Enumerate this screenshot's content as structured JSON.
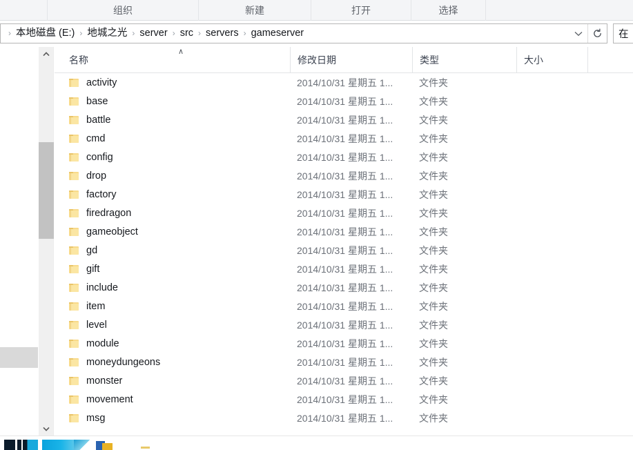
{
  "ribbon": {
    "groups": [
      {
        "label": "组织",
        "name": "organize"
      },
      {
        "label": "新建",
        "name": "new"
      },
      {
        "label": "打开",
        "name": "open"
      },
      {
        "label": "选择",
        "name": "select"
      }
    ]
  },
  "address_bar": {
    "separator": "›",
    "crumbs": [
      "本地磁盘 (E:)",
      "地城之光",
      "server",
      "src",
      "servers",
      "gameserver"
    ],
    "dropdown_icon": "chevron-down-icon",
    "refresh_icon": "refresh-icon"
  },
  "search": {
    "value": "在"
  },
  "columns": {
    "name": "名称",
    "date_modified": "修改日期",
    "type": "类型",
    "size": "大小",
    "sort_indicator": "∧"
  },
  "scrollbar": {
    "up_arrow": "∧",
    "down_arrow": "∨"
  },
  "files": [
    {
      "name": "activity",
      "date": "2014/10/31 星期五 1...",
      "type": "文件夹",
      "size": ""
    },
    {
      "name": "base",
      "date": "2014/10/31 星期五 1...",
      "type": "文件夹",
      "size": ""
    },
    {
      "name": "battle",
      "date": "2014/10/31 星期五 1...",
      "type": "文件夹",
      "size": ""
    },
    {
      "name": "cmd",
      "date": "2014/10/31 星期五 1...",
      "type": "文件夹",
      "size": ""
    },
    {
      "name": "config",
      "date": "2014/10/31 星期五 1...",
      "type": "文件夹",
      "size": ""
    },
    {
      "name": "drop",
      "date": "2014/10/31 星期五 1...",
      "type": "文件夹",
      "size": ""
    },
    {
      "name": "factory",
      "date": "2014/10/31 星期五 1...",
      "type": "文件夹",
      "size": ""
    },
    {
      "name": "firedragon",
      "date": "2014/10/31 星期五 1...",
      "type": "文件夹",
      "size": ""
    },
    {
      "name": "gameobject",
      "date": "2014/10/31 星期五 1...",
      "type": "文件夹",
      "size": ""
    },
    {
      "name": "gd",
      "date": "2014/10/31 星期五 1...",
      "type": "文件夹",
      "size": ""
    },
    {
      "name": "gift",
      "date": "2014/10/31 星期五 1...",
      "type": "文件夹",
      "size": ""
    },
    {
      "name": "include",
      "date": "2014/10/31 星期五 1...",
      "type": "文件夹",
      "size": ""
    },
    {
      "name": "item",
      "date": "2014/10/31 星期五 1...",
      "type": "文件夹",
      "size": ""
    },
    {
      "name": "level",
      "date": "2014/10/31 星期五 1...",
      "type": "文件夹",
      "size": ""
    },
    {
      "name": "module",
      "date": "2014/10/31 星期五 1...",
      "type": "文件夹",
      "size": ""
    },
    {
      "name": "moneydungeons",
      "date": "2014/10/31 星期五 1...",
      "type": "文件夹",
      "size": ""
    },
    {
      "name": "monster",
      "date": "2014/10/31 星期五 1...",
      "type": "文件夹",
      "size": ""
    },
    {
      "name": "movement",
      "date": "2014/10/31 星期五 1...",
      "type": "文件夹",
      "size": ""
    },
    {
      "name": "msg",
      "date": "2014/10/31 星期五 1...",
      "type": "文件夹",
      "size": ""
    }
  ],
  "colors": {
    "ribbon_bg": "#f4f5f7",
    "folder_icon": "#f8da8a",
    "scrollbar_thumb": "#c2c2c2",
    "nav_selection": "#d9d9d9",
    "header_text": "#3c4350",
    "row_text": "#16191e",
    "meta_text": "#6b7078"
  }
}
